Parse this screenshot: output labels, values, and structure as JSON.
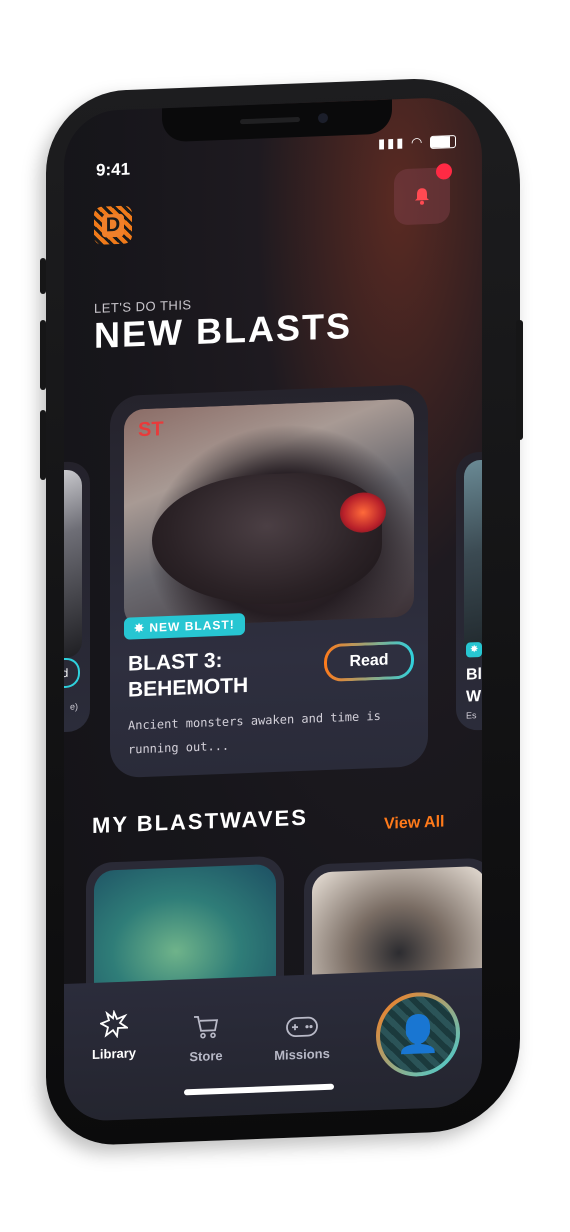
{
  "status_bar": {
    "time": "9:41",
    "signal_icon": "signal-icon",
    "wifi_icon": "wifi-icon",
    "battery_icon": "battery-icon"
  },
  "header": {
    "logo_letter": "D",
    "bell_icon": "bell-icon"
  },
  "hero": {
    "kicker": "LET'S DO THIS",
    "title": "NEW BLASTS"
  },
  "featured": {
    "sign_text": "ST",
    "badge": "✸ NEW BLAST!",
    "title": "BLAST 3: BEHEMOTH",
    "read_label": "Read",
    "description": "Ancient monsters awaken and time is running out..."
  },
  "side_cards": {
    "left": {
      "partial_button": "d",
      "partial_text": "e)"
    },
    "right": {
      "partial_badge": "✸",
      "partial_title": "Bl W",
      "partial_text": "Es"
    }
  },
  "blastwaves": {
    "title": "MY BLASTWAVES",
    "view_all": "View All"
  },
  "tabs": [
    {
      "label": "Library",
      "icon": "library-burst-icon"
    },
    {
      "label": "Store",
      "icon": "cart-icon"
    },
    {
      "label": "Missions",
      "icon": "gamepad-icon"
    }
  ],
  "colors": {
    "accent_orange": "#ff7a1a",
    "accent_cyan": "#27c6d2",
    "notification_red": "#ff2a44"
  }
}
